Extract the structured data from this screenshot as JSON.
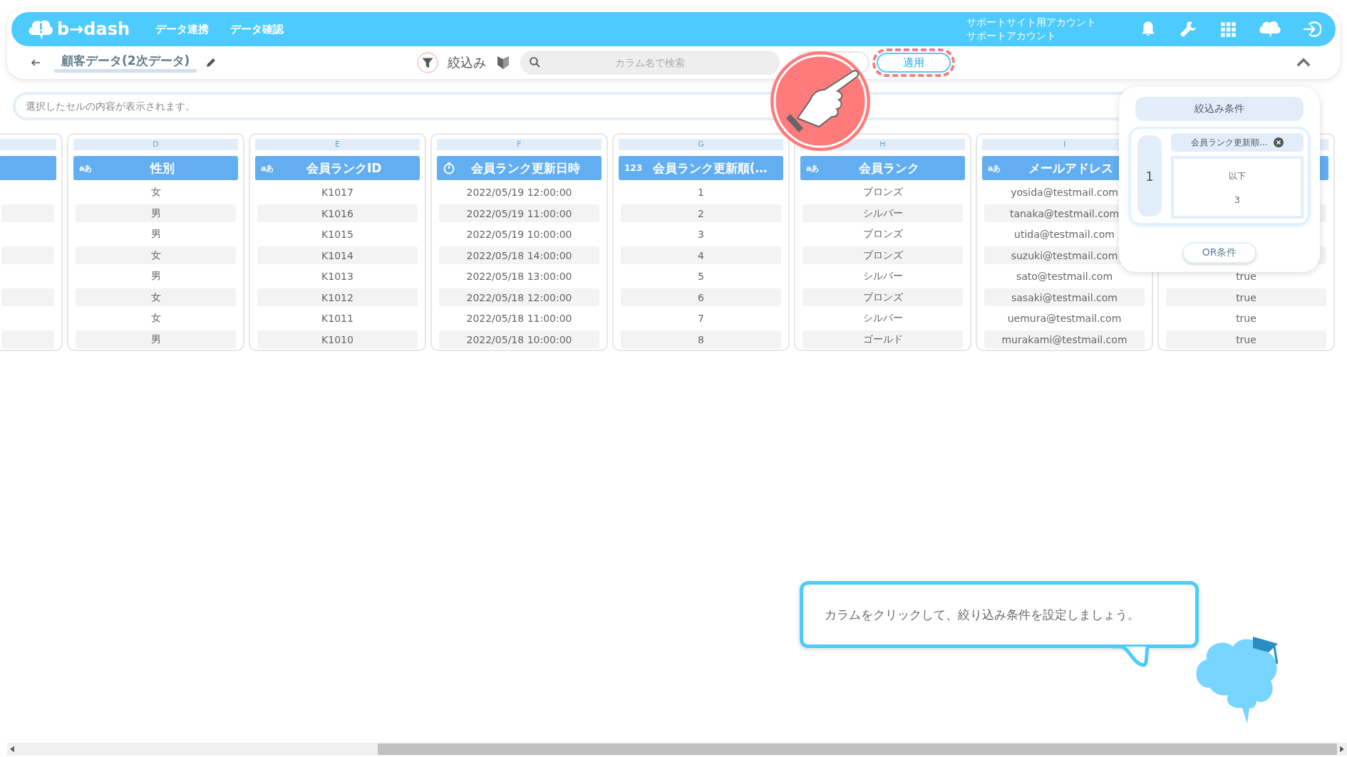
{
  "header": {
    "logo": "b→dash",
    "nav": [
      {
        "label": "データ連携"
      },
      {
        "label": "データ確認"
      }
    ],
    "account": [
      "サポートサイト用アカウント",
      "サポートアカウント"
    ]
  },
  "toolbar": {
    "title": "顧客データ(2次データ)",
    "filter_label": "絞込み",
    "search": {
      "placeholder": "カラム名で検索"
    },
    "apply": "適用"
  },
  "cell_bar": {
    "placeholder": "選択したセルの内容が表示されます。"
  },
  "columns": [
    {
      "cells": [
        null,
        null,
        null,
        null,
        null,
        null,
        null,
        null
      ]
    },
    {
      "letter": "D",
      "kind": "text",
      "type_label": "aあ",
      "header": "性別",
      "cells": [
        "女",
        "男",
        "男",
        "女",
        "男",
        "女",
        "女",
        "男"
      ]
    },
    {
      "letter": "E",
      "kind": "text",
      "type_label": "aあ",
      "header": "会員ランクID",
      "cells": [
        "K1017",
        "K1016",
        "K1015",
        "K1014",
        "K1013",
        "K1012",
        "K1011",
        "K1010"
      ]
    },
    {
      "letter": "F",
      "kind": "datetime",
      "header": "会員ランク更新日時",
      "cells": [
        "2022/05/19 12:00:00",
        "2022/05/19 11:00:00",
        "2022/05/19 10:00:00",
        "2022/05/18 14:00:00",
        "2022/05/18 13:00:00",
        "2022/05/18 12:00:00",
        "2022/05/18 11:00:00",
        "2022/05/18 10:00:00"
      ]
    },
    {
      "letter": "G",
      "kind": "number",
      "type_label": "123",
      "header": "会員ランク更新順(…",
      "cells": [
        "1",
        "2",
        "3",
        "4",
        "5",
        "6",
        "7",
        "8"
      ]
    },
    {
      "letter": "H",
      "kind": "text",
      "type_label": "aあ",
      "header": "会員ランク",
      "cells": [
        "ブロンズ",
        "シルバー",
        "ブロンズ",
        "ブロンズ",
        "シルバー",
        "ブロンズ",
        "シルバー",
        "ゴールド"
      ]
    },
    {
      "letter": "I",
      "kind": "text",
      "type_label": "aあ",
      "header": "メールアドレス",
      "cells": [
        "yosida@testmail.com",
        "tanaka@testmail.com",
        "utida@testmail.com",
        "suzuki@testmail.com",
        "sato@testmail.com",
        "sasaki@testmail.com",
        "uemura@testmail.com",
        "murakami@testmail.com"
      ]
    },
    {
      "cells": [
        null,
        null,
        null,
        null,
        "true",
        "true",
        "true",
        "true"
      ]
    }
  ],
  "filter_panel": {
    "title": "絞込み条件",
    "groups": [
      {
        "number": "1",
        "conditions": [
          {
            "column": "会員ランク更新順…",
            "operator": "以下",
            "value": "3"
          }
        ]
      }
    ],
    "or_button": "OR条件"
  },
  "hint": {
    "text": "カラムをクリックして、絞り込み条件を設定しましょう。"
  }
}
